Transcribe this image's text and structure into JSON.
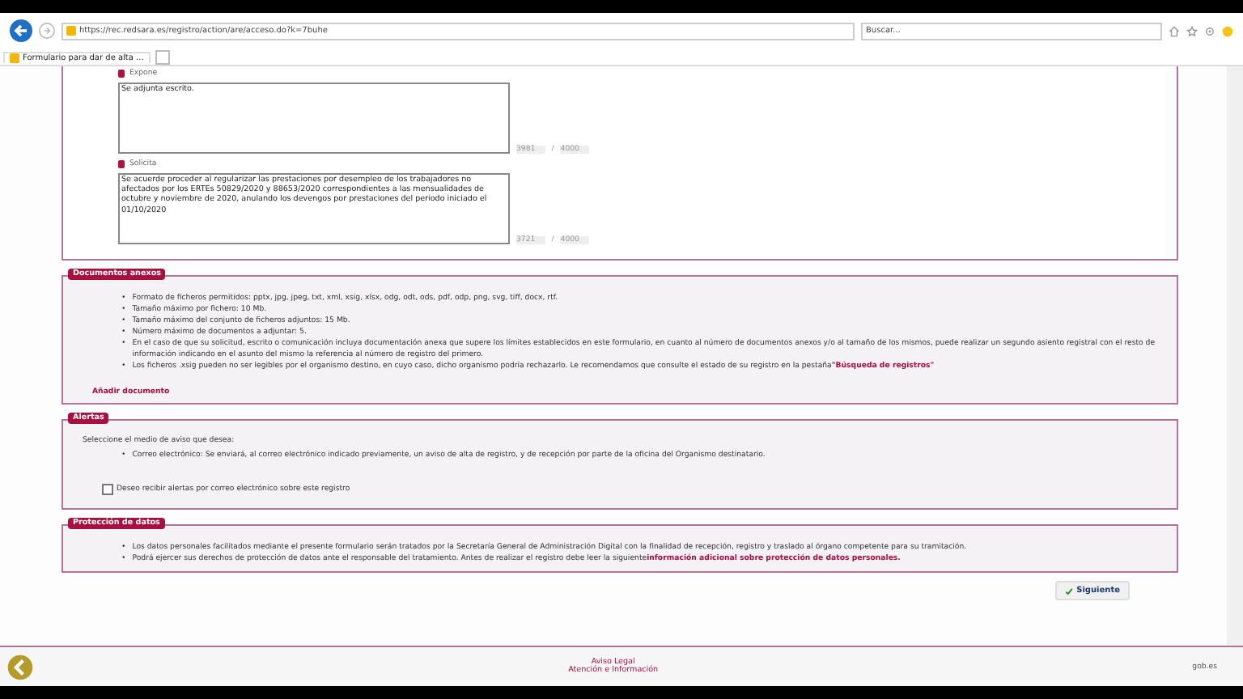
{
  "browser": {
    "url": "https://rec.redsara.es/registro/action/are/acceso.do?k=7buhe",
    "search_placeholder": "Buscar...",
    "tab_title": "Formulario para dar de alta ..."
  },
  "fields": [
    {
      "label": "Expone",
      "value": "Se adjunta escrito.",
      "count": "3981",
      "separator": "/",
      "max": "4000"
    },
    {
      "label": "Solicita",
      "value": "Se acuerde proceder al regularizar las prestaciones por desempleo de los trabajadores no afectados por los ERTEs 50829/2020 y 88653/2020 correspondientes a las mensualidades de octubre y noviembre de 2020, anulando los devengos por prestaciones del periodo iniciado el 01/10/2020",
      "count": "3721",
      "separator": "/",
      "max": "4000"
    }
  ],
  "documentos": {
    "title": "Documentos anexos",
    "items": [
      {
        "bullet": "•",
        "text": "Formato de ficheros permitidos: pptx, jpg, jpeg, txt, xml, xsig, xlsx, odg, odt, ods, pdf, odp, png, svg, tiff, docx, rtf."
      },
      {
        "bullet": "•",
        "text": "Tamaño máximo por fichero: 10 Mb."
      },
      {
        "bullet": "•",
        "text": "Tamaño máximo del conjunto de ficheros adjuntos: 15 Mb."
      },
      {
        "bullet": "•",
        "text": "Número máximo de documentos a adjuntar: 5."
      },
      {
        "bullet": "•",
        "text": "En el caso de que su solicitud, escrito o comunicación incluya documentación anexa que supere los límites establecidos en este formulario, en cuanto al número de documentos anexos y/o al tamaño de los mismos, puede realizar un segundo asiento registral con el resto de información indicando en el asunto del mismo la referencia al número de registro del primero."
      },
      {
        "bullet": "•",
        "text": "Los ficheros .xsig pueden no ser legibles por el organismo destino, en cuyo caso, dicho organismo podría rechazarlo. Le recomendamos que consulte el estado de su registro en la pestaña",
        "link": "\"Búsqueda de registros\""
      }
    ],
    "add_link": "Añadir documento"
  },
  "alertas": {
    "title": "Alertas",
    "intro": "Seleccione el medio de aviso que desea:",
    "items": [
      {
        "bullet": "•",
        "text": "Correo electrónico: Se enviará, al correo electrónico indicado previamente, un aviso de alta de registro, y de recepción por parte de la oficina del Organismo destinatario."
      }
    ],
    "checkbox": {
      "label": "Deseo recibir alertas por correo electrónico sobre este registro",
      "checked": false
    }
  },
  "proteccion": {
    "title": "Protección de datos",
    "items": [
      {
        "bullet": "•",
        "text": "Los datos personales facilitados mediante el presente formulario serán tratados por la Secretaría General de Administración Digital con la finalidad de recepción, registro y traslado al órgano competente para su tramitación."
      },
      {
        "bullet": "•",
        "text": "Podrá ejercer sus derechos de protección de datos ante el responsable del tratamiento. Antes de realizar el registro debe leer la siguiente",
        "link": "información adicional sobre protección de datos personales."
      }
    ]
  },
  "next_button": "Siguiente",
  "footer": {
    "links": [
      "Aviso Legal",
      "Atención e Información"
    ],
    "brand": "gob.es"
  }
}
